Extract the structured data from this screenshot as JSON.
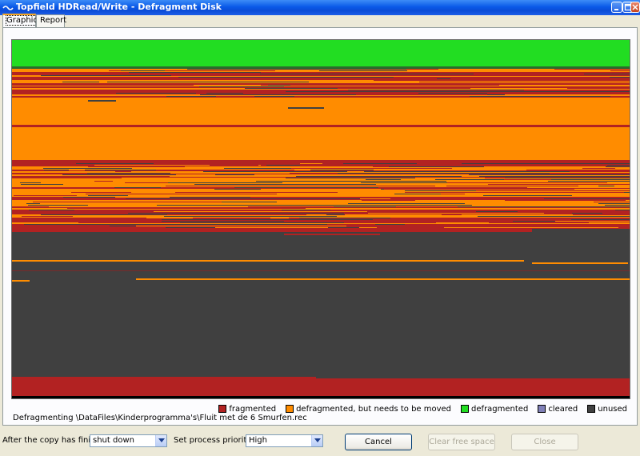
{
  "window": {
    "title": "Topfield HDRead/Write - Defragment Disk",
    "title_icon": "app-icon",
    "controls": [
      "minimize-icon",
      "maximize-icon",
      "close-icon"
    ]
  },
  "tabs": [
    {
      "label": "Graphic",
      "active": true
    },
    {
      "label": "Report",
      "active": false
    }
  ],
  "legend": [
    {
      "label": "fragmented",
      "color": "#b22222"
    },
    {
      "label": "defragmented, but needs to be moved",
      "color": "#ff8c00"
    },
    {
      "label": "defragmented",
      "color": "#22dd22"
    },
    {
      "label": "cleared",
      "color": "#8080b8"
    },
    {
      "label": "unused",
      "color": "#404040"
    }
  ],
  "status_text": "Defragmenting \\DataFiles\\Kinderprogramma's\\Fluit met de 6 Smurfen.rec",
  "after_copy": {
    "label": "After the copy has finished",
    "value": "shut down"
  },
  "priority": {
    "label": "Set process priority to",
    "value": "High"
  },
  "buttons": {
    "cancel": "Cancel",
    "clear_free_space": "Clear free space",
    "close": "Close"
  },
  "colors": {
    "fragmented": "#b22222",
    "needs_move": "#ff8c00",
    "defragmented": "#22dd22",
    "unused": "#404040",
    "title_bar": "#0a5ae8"
  }
}
